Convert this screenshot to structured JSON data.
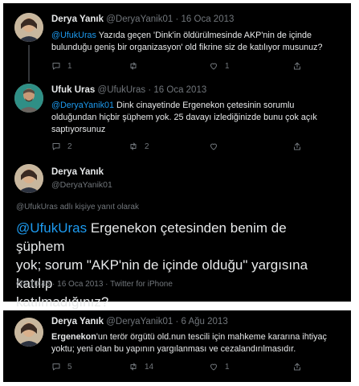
{
  "tweet1": {
    "name": "Derya Yanık",
    "handle": "@DeryaYanik01",
    "sep": "·",
    "date": "16 Oca 2013",
    "mention": "@UfukUras",
    "text_line1": " Yazıda geçen 'Dink'in öldürülmesinde AKP'nin de içinde",
    "text_line2": "bulunduğu geniş bir organizasyon' old fikrine siz de katılıyor musunuz?",
    "replies": "1",
    "retweets": "",
    "likes": "1"
  },
  "tweet2": {
    "name": "Ufuk Uras",
    "handle": "@UfukUras",
    "sep": "·",
    "date": "16 Oca 2013",
    "mention": "@DeryaYanik01",
    "text_line1": " Dink cinayetinde Ergenekon çetesinin sorumlu",
    "text_line2": "olduğundan hiçbir şüphem yok. 25 davayı izlediğinizde bunu çok açık",
    "text_line3": "saptıyorsunuz",
    "replies": "2",
    "retweets": "2",
    "likes": ""
  },
  "tweet3": {
    "name": "Derya Yanık",
    "handle": "@DeryaYanik01",
    "reply_context": "@UfukUras adlı kişiye yanıt olarak",
    "mention": "@UfukUras",
    "text_line1": " Ergenekon çetesinden benim de şüphem",
    "text_line2": "yok; sorum \"AKP'nin de içinde olduğu\" yargısına katılıp",
    "text_line3": "katılmadığınız?",
    "timestamp": "ÖS 10:45 · 16 Oca 2013 · Twitter for iPhone"
  },
  "tweet4": {
    "name": "Derya Yanık",
    "handle": "@DeryaYanik01",
    "sep": "·",
    "date": "6 Ağu 2013",
    "bold_word": "Ergenekon",
    "text_line1": "'un terör örgütü old.nun tescili için mahkeme kararına ihtiyaç",
    "text_line2": "yoktu; yeni olan bu yapının yargılanması ve cezalandırılmasıdır.",
    "replies": "5",
    "retweets": "14",
    "likes": "1"
  },
  "colors": {
    "background": "#000000",
    "text": "#e7e9ea",
    "muted": "#71767b",
    "link": "#1d9bf0"
  },
  "icons": [
    "reply-icon",
    "retweet-icon",
    "like-icon",
    "share-icon"
  ]
}
